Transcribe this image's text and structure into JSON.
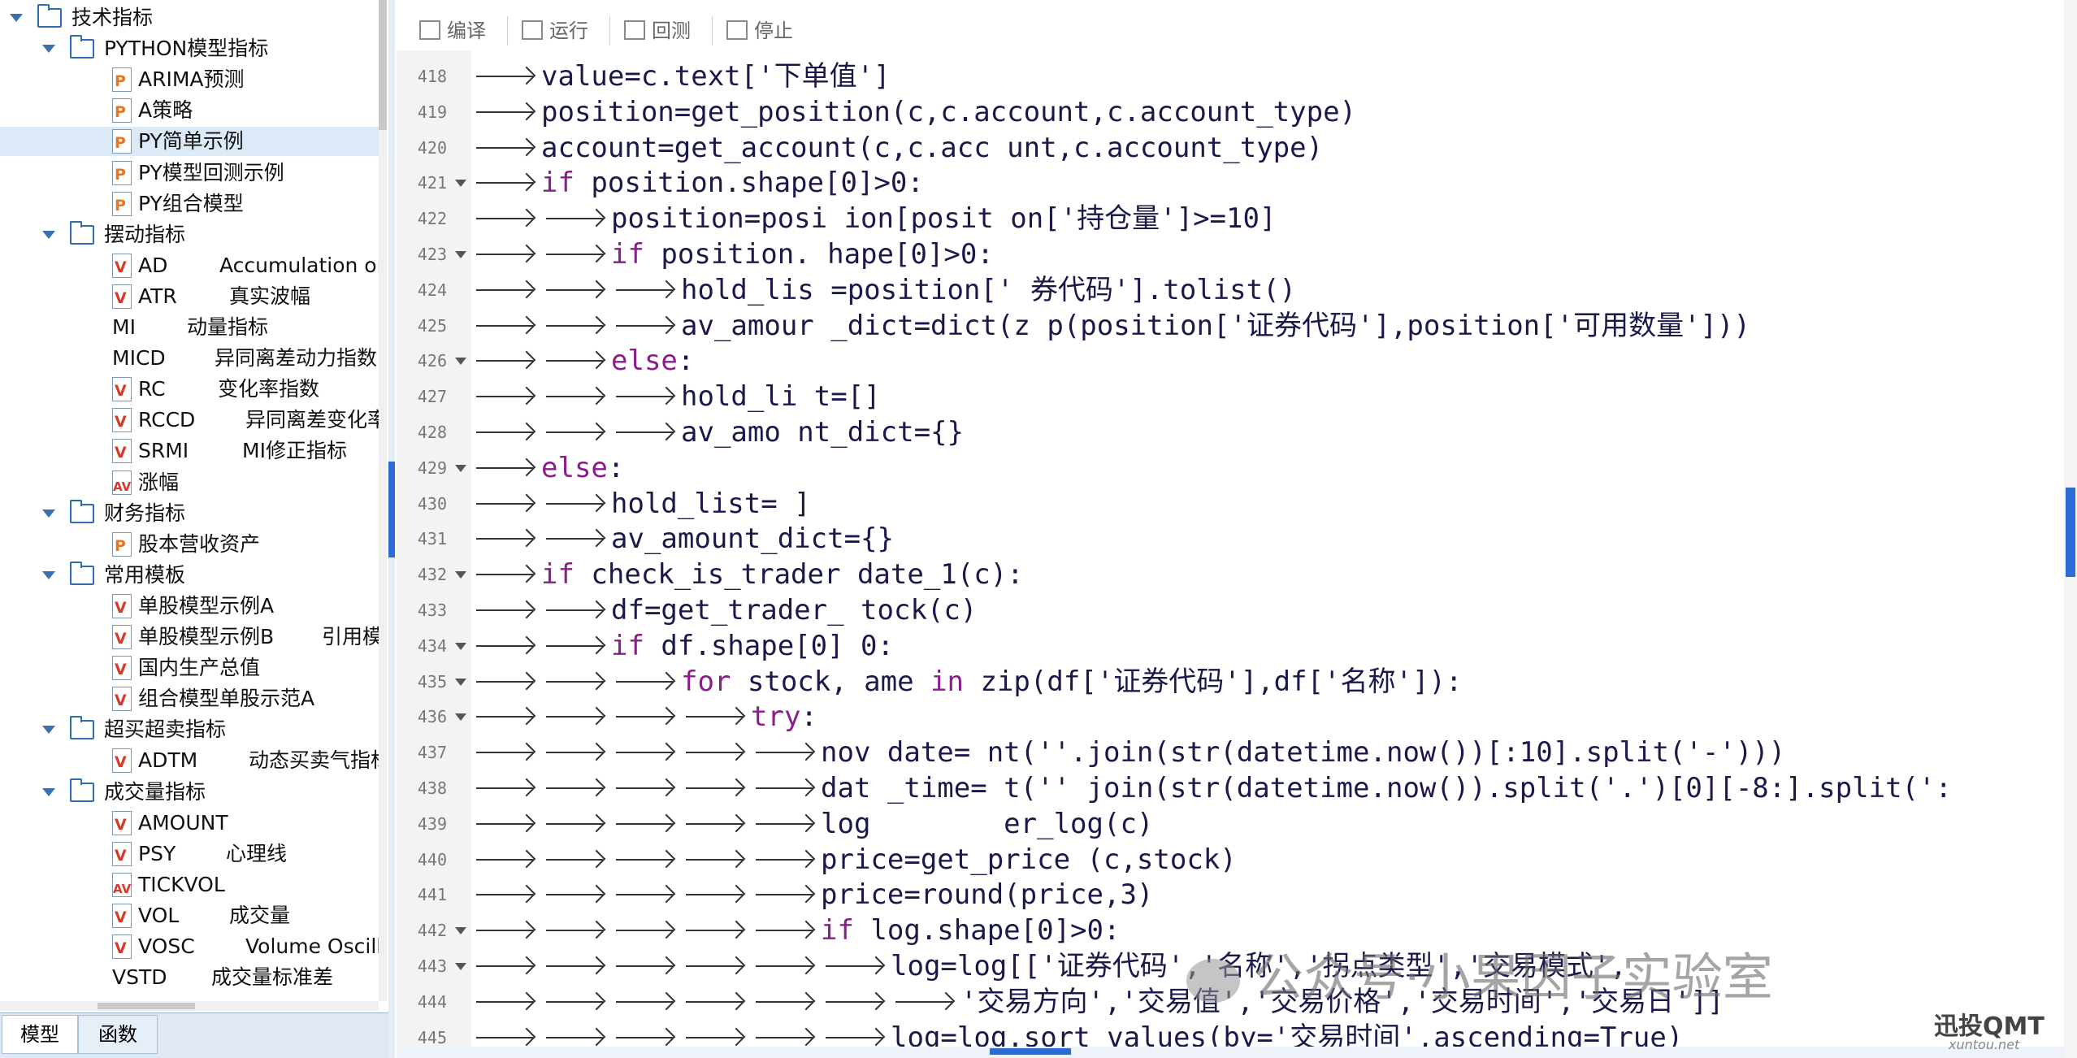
{
  "tree": [
    {
      "level": 0,
      "type": "folder",
      "expanded": true,
      "label": "技术指标"
    },
    {
      "level": 1,
      "type": "folder",
      "expanded": true,
      "label": "PYTHON模型指标"
    },
    {
      "level": 2,
      "type": "file",
      "icon": "p",
      "label": "ARIMA预测"
    },
    {
      "level": 2,
      "type": "file",
      "icon": "p",
      "label": "A策略"
    },
    {
      "level": 2,
      "type": "file",
      "icon": "p",
      "label": "PY简单示例",
      "selected": true
    },
    {
      "level": 2,
      "type": "file",
      "icon": "p",
      "label": "PY模型回测示例"
    },
    {
      "level": 2,
      "type": "file",
      "icon": "p",
      "label": "PY组合模型"
    },
    {
      "level": 1,
      "type": "folder",
      "expanded": true,
      "label": "摆动指标"
    },
    {
      "level": 2,
      "type": "file",
      "icon": "v",
      "label": "AD",
      "desc": "Accumulation or"
    },
    {
      "level": 2,
      "type": "file",
      "icon": "v",
      "label": "ATR",
      "desc": "真实波幅"
    },
    {
      "level": 2,
      "type": "file",
      "icon": "v",
      "label": "MI",
      "desc": "动量指标"
    },
    {
      "level": 2,
      "type": "file",
      "icon": "v",
      "label": "MICD",
      "desc": "异同离差动力指数"
    },
    {
      "level": 2,
      "type": "file",
      "icon": "v",
      "label": "RC",
      "desc": "变化率指数"
    },
    {
      "level": 2,
      "type": "file",
      "icon": "v",
      "label": "RCCD",
      "desc": "异同离差变化率"
    },
    {
      "level": 2,
      "type": "file",
      "icon": "v",
      "label": "SRMI",
      "desc": "MI修正指标"
    },
    {
      "level": 2,
      "type": "file",
      "icon": "av",
      "label": "涨幅"
    },
    {
      "level": 1,
      "type": "folder",
      "expanded": true,
      "label": "财务指标"
    },
    {
      "level": 2,
      "type": "file",
      "icon": "p",
      "label": "股本营收资产"
    },
    {
      "level": 1,
      "type": "folder",
      "expanded": true,
      "label": "常用模板"
    },
    {
      "level": 2,
      "type": "file",
      "icon": "v",
      "label": "单股模型示例A"
    },
    {
      "level": 2,
      "type": "file",
      "icon": "v",
      "label": "单股模型示例B",
      "desc": "引用模"
    },
    {
      "level": 2,
      "type": "file",
      "icon": "v",
      "label": "国内生产总值"
    },
    {
      "level": 2,
      "type": "file",
      "icon": "v",
      "label": "组合模型单股示范A"
    },
    {
      "level": 1,
      "type": "folder",
      "expanded": true,
      "label": "超买超卖指标"
    },
    {
      "level": 2,
      "type": "file",
      "icon": "v",
      "label": "ADTM",
      "desc": "动态买卖气指标"
    },
    {
      "level": 1,
      "type": "folder",
      "expanded": true,
      "label": "成交量指标"
    },
    {
      "level": 2,
      "type": "file",
      "icon": "v",
      "label": "AMOUNT"
    },
    {
      "level": 2,
      "type": "file",
      "icon": "v",
      "label": "PSY",
      "desc": "心理线"
    },
    {
      "level": 2,
      "type": "file",
      "icon": "av",
      "label": "TICKVOL"
    },
    {
      "level": 2,
      "type": "file",
      "icon": "v",
      "label": "VOL",
      "desc": "成交量"
    },
    {
      "level": 2,
      "type": "file",
      "icon": "v",
      "label": "VOSC",
      "desc": "Volume Oscilla"
    },
    {
      "level": 2,
      "type": "file",
      "icon": "v",
      "label": "VSTD",
      "desc": "成交量标准差"
    }
  ],
  "bottom_tabs": [
    "模型",
    "函数"
  ],
  "toolbar": {
    "compile": "编译",
    "run": "运行",
    "backtest": "回测",
    "stop": "停止"
  },
  "code_lines": [
    {
      "n": "418",
      "indent": 1,
      "fold": false,
      "text": "value=c.text['下单值']"
    },
    {
      "n": "419",
      "indent": 1,
      "fold": false,
      "text": "position=get_position(c,c.account,c.account_type)"
    },
    {
      "n": "420",
      "indent": 1,
      "fold": false,
      "text": "account=get_account(c,c.acc unt,c.account_type)"
    },
    {
      "n": "421",
      "indent": 1,
      "fold": true,
      "text": "if position.shape[0]>0:"
    },
    {
      "n": "422",
      "indent": 2,
      "fold": false,
      "text": "position=posi ion[posit on['持仓量']>=10]"
    },
    {
      "n": "423",
      "indent": 2,
      "fold": true,
      "text": "if position. hape[0]>0:"
    },
    {
      "n": "424",
      "indent": 3,
      "fold": false,
      "text": "hold_lis =position[' 券代码'].tolist()"
    },
    {
      "n": "425",
      "indent": 3,
      "fold": false,
      "text": "av_amour _dict=dict(z p(position['证券代码'],position['可用数量']))"
    },
    {
      "n": "426",
      "indent": 2,
      "fold": true,
      "text": "else:"
    },
    {
      "n": "427",
      "indent": 3,
      "fold": false,
      "text": "hold_li t=[]"
    },
    {
      "n": "428",
      "indent": 3,
      "fold": false,
      "text": "av_amo nt_dict={}"
    },
    {
      "n": "429",
      "indent": 1,
      "fold": true,
      "text": "else:"
    },
    {
      "n": "430",
      "indent": 2,
      "fold": false,
      "text": "hold_list= ]"
    },
    {
      "n": "431",
      "indent": 2,
      "fold": false,
      "text": "av_amount_dict={}"
    },
    {
      "n": "432",
      "indent": 1,
      "fold": true,
      "text": "if check_is_trader date_1(c):"
    },
    {
      "n": "433",
      "indent": 2,
      "fold": false,
      "text": "df=get_trader_ tock(c)"
    },
    {
      "n": "434",
      "indent": 2,
      "fold": true,
      "text": "if df.shape[0] 0:"
    },
    {
      "n": "435",
      "indent": 3,
      "fold": true,
      "text": "for stock, ame in zip(df['证券代码'],df['名称']):"
    },
    {
      "n": "436",
      "indent": 4,
      "fold": true,
      "text": "try:"
    },
    {
      "n": "437",
      "indent": 5,
      "fold": false,
      "text": "nov date= nt(''.join(str(datetime.now())[:10].split('-')))"
    },
    {
      "n": "438",
      "indent": 5,
      "fold": false,
      "text": "dat _time= t('' join(str(datetime.now()).split('.')[0][-8:].split(':"
    },
    {
      "n": "439",
      "indent": 5,
      "fold": false,
      "text": "log        er_log(c)"
    },
    {
      "n": "440",
      "indent": 5,
      "fold": false,
      "text": "price=get_price (c,stock)"
    },
    {
      "n": "441",
      "indent": 5,
      "fold": false,
      "text": "price=round(price,3)"
    },
    {
      "n": "442",
      "indent": 5,
      "fold": true,
      "text": "if log.shape[0]>0:"
    },
    {
      "n": "443",
      "indent": 6,
      "fold": true,
      "text": "log=log[['证券代码','名称','拐点类型','交易模式',"
    },
    {
      "n": "444",
      "indent": 7,
      "fold": false,
      "text": "'交易方向','交易值','交易价格','交易时间','交易日']]"
    },
    {
      "n": "445",
      "indent": 6,
      "fold": false,
      "text": "log=log.sort values(by='交易时间',ascending=True)"
    }
  ],
  "watermark": "公众号·小果因子实验室",
  "brand": "迅投QMT",
  "brand_sub": "xuntou.net",
  "colors": {
    "accent": "#2c6bd6",
    "keyword": "#8b1c8b",
    "code": "#1a1a4a",
    "selected_row": "#dce9f7"
  }
}
